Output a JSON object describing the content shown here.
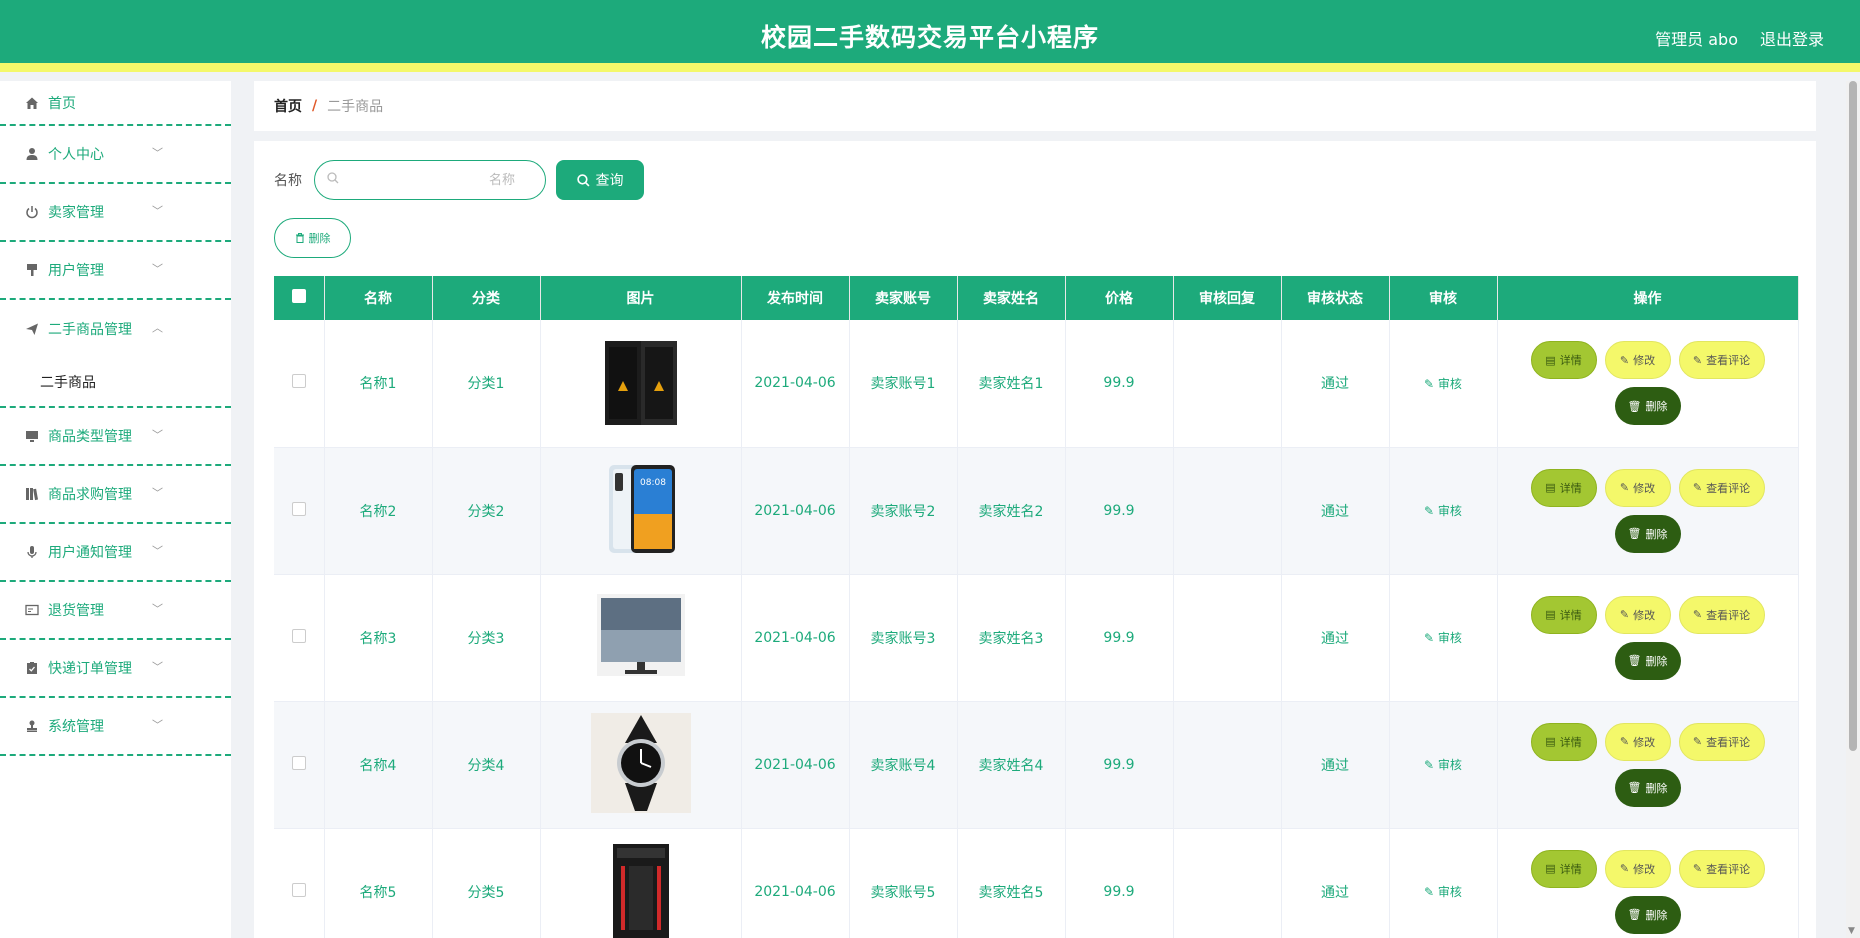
{
  "header": {
    "title": "校园二手数码交易平台小程序",
    "user_label": "管理员 abo",
    "logout_label": "退出登录"
  },
  "sidebar": {
    "items": [
      {
        "label": "首页",
        "icon": "home-icon"
      },
      {
        "label": "个人中心",
        "icon": "user-icon"
      },
      {
        "label": "卖家管理",
        "icon": "power-icon"
      },
      {
        "label": "用户管理",
        "icon": "brush-icon"
      },
      {
        "label": "二手商品管理",
        "icon": "send-icon"
      },
      {
        "label": "二手商品"
      },
      {
        "label": "商品类型管理",
        "icon": "monitor-icon"
      },
      {
        "label": "商品求购管理",
        "icon": "books-icon"
      },
      {
        "label": "用户通知管理",
        "icon": "mic-icon"
      },
      {
        "label": "退货管理",
        "icon": "card-icon"
      },
      {
        "label": "快递订单管理",
        "icon": "clipboard-icon"
      },
      {
        "label": "系统管理",
        "icon": "stamp-icon"
      }
    ]
  },
  "breadcrumb": {
    "home": "首页",
    "sep": "/",
    "current": "二手商品"
  },
  "search": {
    "label": "名称",
    "placeholder": "名称",
    "button": "查询"
  },
  "toolbar": {
    "delete_label": "删除"
  },
  "table": {
    "columns": [
      "名称",
      "分类",
      "图片",
      "发布时间",
      "卖家账号",
      "卖家姓名",
      "价格",
      "审核回复",
      "审核状态",
      "审核",
      "操作"
    ],
    "rows": [
      {
        "name": "名称1",
        "category": "分类1",
        "image": "speaker",
        "date": "2021-04-06",
        "account": "卖家账号1",
        "seller": "卖家姓名1",
        "price": "99.9",
        "reply": "",
        "status": "通过",
        "audit": "审核"
      },
      {
        "name": "名称2",
        "category": "分类2",
        "image": "phone",
        "date": "2021-04-06",
        "account": "卖家账号2",
        "seller": "卖家姓名2",
        "price": "99.9",
        "reply": "",
        "status": "通过",
        "audit": "审核"
      },
      {
        "name": "名称3",
        "category": "分类3",
        "image": "monitor",
        "date": "2021-04-06",
        "account": "卖家账号3",
        "seller": "卖家姓名3",
        "price": "99.9",
        "reply": "",
        "status": "通过",
        "audit": "审核"
      },
      {
        "name": "名称4",
        "category": "分类4",
        "image": "watch",
        "date": "2021-04-06",
        "account": "卖家账号4",
        "seller": "卖家姓名4",
        "price": "99.9",
        "reply": "",
        "status": "通过",
        "audit": "审核"
      },
      {
        "name": "名称5",
        "category": "分类5",
        "image": "pc-case",
        "date": "2021-04-06",
        "account": "卖家账号5",
        "seller": "卖家姓名5",
        "price": "99.9",
        "reply": "",
        "status": "通过",
        "audit": "审核"
      }
    ],
    "actions": {
      "detail": "详情",
      "edit": "修改",
      "comments": "查看评论",
      "delete": "删除"
    },
    "phone_time": "08:08"
  },
  "colors": {
    "primary": "#1daa7b",
    "accent_yellow": "#f4f86a",
    "olive": "#a3c732",
    "dark_green": "#2d5d12"
  }
}
